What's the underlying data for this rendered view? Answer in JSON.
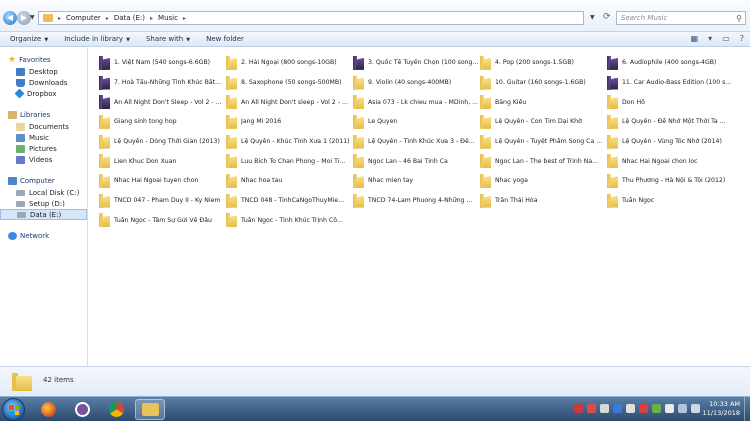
{
  "address": {
    "crumbs": [
      "Computer",
      "Data (E:)",
      "Music"
    ],
    "search_placeholder": "Search Music"
  },
  "toolbar": {
    "commands": [
      "Organize",
      "Include in library",
      "Share with",
      "New folder"
    ]
  },
  "navpane": {
    "favorites": {
      "label": "Favorites",
      "items": [
        "Desktop",
        "Downloads",
        "Dropbox"
      ]
    },
    "libraries": {
      "label": "Libraries",
      "items": [
        "Documents",
        "Music",
        "Pictures",
        "Videos"
      ]
    },
    "computer": {
      "label": "Computer",
      "items": [
        "Local Disk (C:)",
        "Setup (D:)",
        "Data (E:)"
      ]
    },
    "network": {
      "label": "Network"
    }
  },
  "folders": [
    "1. Việt Nam (540 songs-6.6GB)",
    "2. Hải Ngoại (800 songs-10GB)",
    "3. Quốc Tế Tuyển Chọn (100 songs-...",
    "4. Pop (200 songs-1.5GB)",
    "6. Audiophile (400 songs-4GB)",
    "7. Hoà Tấu-Những Tình Khúc Bất...",
    "8. Saxophone (50 songs-500MB)",
    "9. Violin (40 songs-400MB)",
    "10. Guitar (160 songs-1.6GB)",
    "11. Car Audio-Bass Edition (100 s...",
    "An All Night Don't Sleep - Vol 2 - ...",
    "An All Night Don't sleep - Vol 2 - ...",
    "Asia 073 - Lk chieu mua - MDinh, ...",
    "Bằng Kiều",
    "Don Hồ",
    "Giang sinh tong hop",
    "Jang Mi 2016",
    "Le Quyen",
    "Lệ Quyên - Con Tim Dại Khờ",
    "Lệ Quyên - Để Nhớ Một Thời Ta ...",
    "Lệ Quyên - Dòng Thời Gian (2013)",
    "Lệ Quyên - Khúc Tình Xưa 1 (2011)",
    "Lệ Quyên - Tình Khúc Xưa 3 - Đê...",
    "Lệ Quyên - Tuyệt Phẩm Song Ca ...",
    "Lệ Quyên - Vùng Tóc Nhớ (2014)",
    "Lien Khuc Don Xuan",
    "Luu Bich To Chan Phong - Moi Ti...",
    "Ngoc Lan - 46 Bai Tinh Ca",
    "Ngoc Lan - The best of Trinh Na...",
    "Nhac Hai Ngoai chon loc",
    "Nhac Hai Ngoai tuyen chon",
    "Nhac hoa tau",
    "Nhac mien tay",
    "Nhac yoga",
    "Thu Phương - Hà Nội & Tôi (2012)",
    "TNCD 047 - Pham Duy II - Ky Niem",
    "TNCD 048 - TinhCaNgoThuyMie...",
    "TNCD 74-Lam Phuong 4-Những ...",
    "Trần Thái Hòa",
    "Tuấn Ngọc",
    "Tuấn Ngọc - Tâm Sự Gửi Về Đâu",
    "Tuấn Ngọc - Tình Khúc Trịnh Cô..."
  ],
  "art_folders": [
    0,
    2,
    4,
    5,
    9,
    10
  ],
  "details": {
    "count": "42 items"
  },
  "taskbar": {
    "time": "10:33 AM",
    "date": "11/13/2018"
  }
}
